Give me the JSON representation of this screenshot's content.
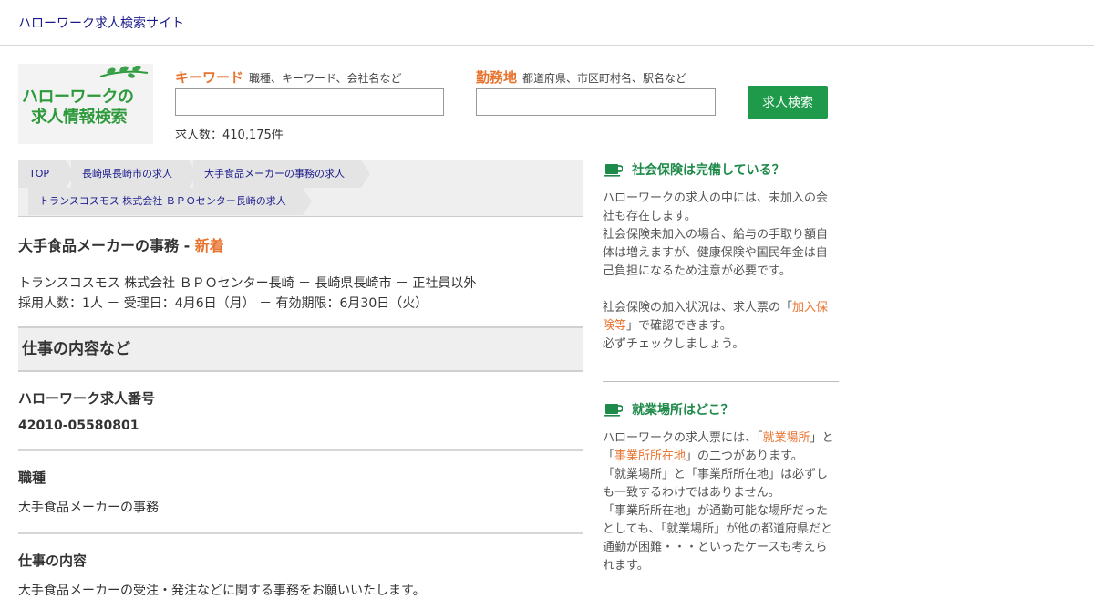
{
  "header": {
    "site_title": "ハローワーク求人検索サイト"
  },
  "logo": {
    "line1": "ハローワークの",
    "line2": "求人情報検索"
  },
  "search": {
    "keyword_label": "キーワード",
    "keyword_hint": "職種、キーワード、会社名など",
    "keyword_value": "",
    "location_label": "勤務地",
    "location_hint": "都道府県、市区町村名、駅名など",
    "location_value": "",
    "button_label": "求人検索",
    "count_text": "求人数：410,175件"
  },
  "breadcrumb": {
    "items": [
      "TOP",
      "長崎県長崎市の求人",
      "大手食品メーカーの事務の求人",
      "トランスコスモス 株式会社 ＢＰＯセンター長崎の求人"
    ]
  },
  "job": {
    "title": "大手食品メーカーの事務 - ",
    "new_label": "新着",
    "meta_line1": "トランスコスモス 株式会社 ＢＰＯセンター長崎 － 長崎県長崎市 － 正社員以外",
    "meta_line2": "採用人数：1人 － 受理日：4月6日（月） － 有効期限：6月30日（火）",
    "section_title": "仕事の内容など",
    "fields": [
      {
        "label": "ハローワーク求人番号",
        "value": "42010-05580801"
      },
      {
        "label": "職種",
        "value": "大手食品メーカーの事務"
      },
      {
        "label": "仕事の内容",
        "value": "大手食品メーカーの受注・発注などに関する事務をお願いいたします。"
      }
    ]
  },
  "sidebar": {
    "box1": {
      "title": "社会保険は完備している？",
      "p1": "ハローワークの求人の中には、未加入の会社も存在します。",
      "p2": "社会保険未加入の場合、給与の手取り額自体は増えますが、健康保険や国民年金は自己負担になるため注意が必要です。",
      "p3_pre": "社会保険の加入状況は、求人票の「",
      "p3_link": "加入保険等",
      "p3_post": "」で確認できます。",
      "p4": "必ずチェックしましょう。"
    },
    "box2": {
      "title": "就業場所はどこ？",
      "p1_pre": "ハローワークの求人票には、「",
      "p1_link1": "就業場所",
      "p1_mid": "」と「",
      "p1_link2": "事業所所在地",
      "p1_post": "」の二つがあります。",
      "p2": "「就業場所」と「事業所所在地」は必ずしも一致するわけではありません。",
      "p3": "「事業所所在地」が通勤可能な場所だったとしても、「就業場所」が他の都道府県だと通勤が困難・・・といったケースも考えられます。"
    }
  },
  "colors": {
    "accent_orange": "#e8732e",
    "brand_green": "#1e9a4a",
    "link_blue": "#1a1a8c"
  },
  "icons": {
    "logo_leaf": "leaf-icon",
    "side_cup": "cup-icon"
  }
}
